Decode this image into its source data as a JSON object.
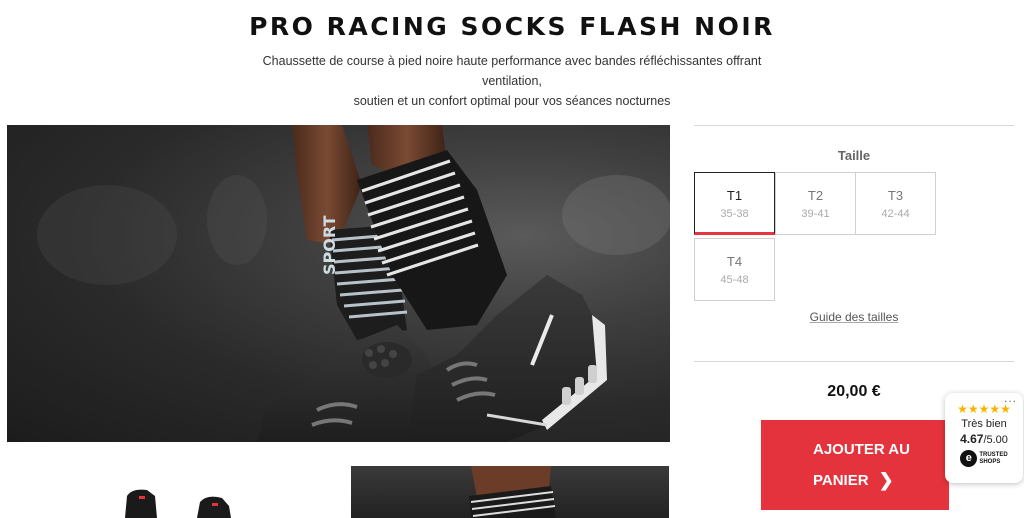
{
  "product": {
    "title": "PRO RACING SOCKS FLASH NOIR",
    "description_line1": "Chaussette de course à pied noire haute performance avec bandes réfléchissantes offrant ventilation,",
    "description_line2": "soutien et un confort optimal pour vos séances nocturnes"
  },
  "size_selector": {
    "label": "Taille",
    "selected": "T1",
    "options": [
      {
        "name": "T1",
        "range": "35-38"
      },
      {
        "name": "T2",
        "range": "39-41"
      },
      {
        "name": "T3",
        "range": "42-44"
      },
      {
        "name": "T4",
        "range": "45-48"
      }
    ],
    "guide_link": "Guide des tailles"
  },
  "purchase": {
    "price": "20,00 €",
    "cart_line1": "AJOUTER AU",
    "cart_line2": "PANIER",
    "accent_color": "#e5333d"
  },
  "trusted_shops": {
    "stars": "★★★★★",
    "rating_text": "Très bien",
    "score": "4.67",
    "score_max": "/5.00",
    "logo_letter": "e",
    "logo_line1": "TRUSTED",
    "logo_line2": "SHOPS",
    "menu": "..."
  },
  "images": {
    "hero_sock_text": "SPORT",
    "hero_alt_icon": "sock-shoe-photo"
  }
}
